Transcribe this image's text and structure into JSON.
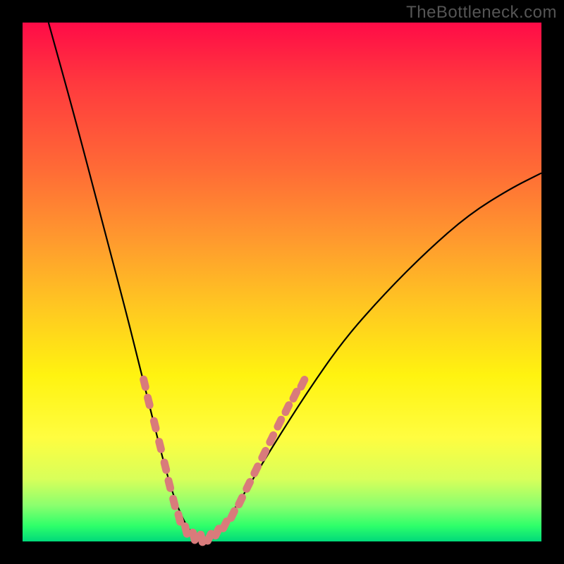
{
  "watermark": "TheBottleneck.com",
  "colors": {
    "background": "#000000",
    "curve_stroke": "#000000",
    "marker_fill": "#d97b7b",
    "gradient_stops": [
      "#ff0b47",
      "#ff3a3e",
      "#ff6a36",
      "#ff9a2e",
      "#ffc821",
      "#fff310",
      "#fffd40",
      "#d8ff5a",
      "#8cff6e",
      "#2eff6a",
      "#00d97a"
    ]
  },
  "chart_data": {
    "type": "line",
    "title": "",
    "xlabel": "",
    "ylabel": "",
    "xlim": [
      0,
      100
    ],
    "ylim": [
      0,
      100
    ],
    "series": [
      {
        "name": "bottleneck-curve",
        "x": [
          5,
          10,
          15,
          20,
          22,
          25,
          27,
          29,
          31,
          33,
          35,
          38,
          42,
          48,
          55,
          62,
          70,
          78,
          86,
          94,
          100
        ],
        "values": [
          100,
          82,
          63,
          44,
          36,
          24,
          16,
          9,
          4,
          1,
          0,
          2,
          8,
          18,
          29,
          39,
          48,
          56,
          63,
          68,
          71
        ]
      }
    ],
    "markers": [
      {
        "x": 23.5,
        "y": 30.5
      },
      {
        "x": 24.3,
        "y": 27.0
      },
      {
        "x": 25.5,
        "y": 22.5
      },
      {
        "x": 26.5,
        "y": 18.5
      },
      {
        "x": 27.5,
        "y": 14.5
      },
      {
        "x": 28.3,
        "y": 11.0
      },
      {
        "x": 29.2,
        "y": 7.5
      },
      {
        "x": 30.2,
        "y": 4.5
      },
      {
        "x": 31.5,
        "y": 2.2
      },
      {
        "x": 33.0,
        "y": 1.0
      },
      {
        "x": 34.5,
        "y": 0.6
      },
      {
        "x": 36.0,
        "y": 0.8
      },
      {
        "x": 37.5,
        "y": 1.8
      },
      {
        "x": 39.0,
        "y": 3.2
      },
      {
        "x": 40.5,
        "y": 5.2
      },
      {
        "x": 42.0,
        "y": 7.8
      },
      {
        "x": 43.5,
        "y": 10.8
      },
      {
        "x": 45.0,
        "y": 13.8
      },
      {
        "x": 46.5,
        "y": 16.8
      },
      {
        "x": 48.0,
        "y": 19.8
      },
      {
        "x": 49.5,
        "y": 22.8
      },
      {
        "x": 51.0,
        "y": 25.6
      },
      {
        "x": 52.5,
        "y": 28.2
      },
      {
        "x": 54.0,
        "y": 30.5
      }
    ]
  }
}
